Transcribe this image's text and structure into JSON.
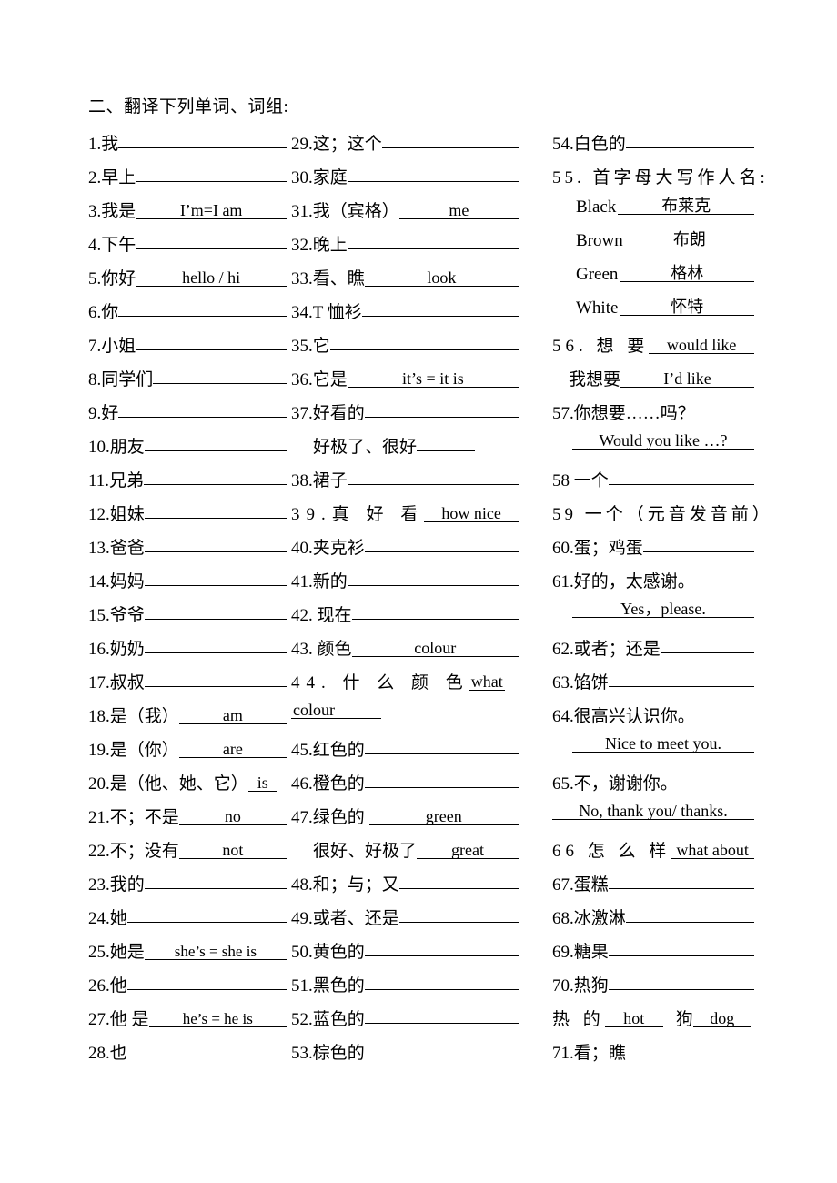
{
  "document": {
    "heading": "二、翻译下列单词、词组:"
  },
  "columns": [
    {
      "name": "column-1",
      "entries": [
        {
          "num": "1.",
          "label": "我",
          "answer": ""
        },
        {
          "num": "2.",
          "label": "早上",
          "answer": ""
        },
        {
          "num": "3.",
          "label": "我是",
          "answer": "I’m=I am"
        },
        {
          "num": "4.",
          "label": "下午",
          "answer": ""
        },
        {
          "num": "5.",
          "label": "你好",
          "answer": "hello / hi"
        },
        {
          "num": "6.",
          "label": "你",
          "answer": ""
        },
        {
          "num": "7.",
          "label": "小姐",
          "answer": ""
        },
        {
          "num": "8.",
          "label": "同学们",
          "answer": ""
        },
        {
          "num": "9.",
          "label": "好",
          "answer": ""
        },
        {
          "num": "10.",
          "label": "朋友",
          "answer": ""
        },
        {
          "num": "11.",
          "label": "兄弟",
          "answer": ""
        },
        {
          "num": "12.",
          "label": "姐妹",
          "answer": ""
        },
        {
          "num": "13.",
          "label": "爸爸",
          "answer": ""
        },
        {
          "num": "14.",
          "label": "妈妈",
          "answer": ""
        },
        {
          "num": "15.",
          "label": "爷爷",
          "answer": ""
        },
        {
          "num": "16.",
          "label": "奶奶",
          "answer": ""
        },
        {
          "num": "17.",
          "label": "叔叔",
          "answer": ""
        },
        {
          "num": "18.",
          "label": "是（我）",
          "answer": "am"
        },
        {
          "num": "19.",
          "label": "是（你）",
          "answer": "are"
        },
        {
          "num": "20.",
          "label": "是（他、她、它）",
          "answer": "is"
        },
        {
          "num": "21.",
          "label": "不；不是",
          "answer": "no"
        },
        {
          "num": "22.",
          "label": "不；没有",
          "answer": "not"
        },
        {
          "num": "23.",
          "label": "我的",
          "answer": ""
        },
        {
          "num": "24.",
          "label": "她",
          "answer": ""
        },
        {
          "num": "25.",
          "label": "她是",
          "answer": "she’s = she is"
        },
        {
          "num": "26.",
          "label": "他",
          "answer": ""
        },
        {
          "num": "27.",
          "label": "他 是",
          "answer": "he’s = he is"
        },
        {
          "num": "28.",
          "label": "也",
          "answer": ""
        }
      ]
    },
    {
      "name": "column-2",
      "entries": [
        {
          "num": "29.",
          "label": "这；这个",
          "answer": ""
        },
        {
          "num": "30.",
          "label": "家庭",
          "answer": ""
        },
        {
          "num": "31.",
          "label": "我（宾格）",
          "answer": "me"
        },
        {
          "num": "32.",
          "label": "晚上",
          "answer": ""
        },
        {
          "num": "33.",
          "label": "看、瞧",
          "answer": "look"
        },
        {
          "num": "34.",
          "label": "T 恤衫",
          "answer": ""
        },
        {
          "num": "35.",
          "label": "它",
          "answer": ""
        },
        {
          "num": "36.",
          "label": "它是",
          "answer": "it’s = it is"
        },
        {
          "num": "37.",
          "label": "好看的",
          "answer": ""
        },
        {
          "num": "",
          "label": "好极了、很好",
          "answer": "",
          "sub": true
        },
        {
          "num": "38.",
          "label": "裙子",
          "answer": ""
        },
        {
          "num": "39.",
          "label": "真 好 看",
          "answer": "how  nice"
        },
        {
          "num": "40.",
          "label": "夹克衫",
          "answer": ""
        },
        {
          "num": "41.",
          "label": "新的",
          "answer": ""
        },
        {
          "num": "42.",
          "label": "现在",
          "answer": ""
        },
        {
          "num": "43.",
          "label": "颜色",
          "answer": "colour"
        },
        {
          "num": "44.",
          "label": "什 么 颜 色",
          "answer": "what"
        },
        {
          "num": "",
          "label": "",
          "answer": "colour",
          "wrap": true
        },
        {
          "num": "45.",
          "label": "红色的",
          "answer": ""
        },
        {
          "num": "46.",
          "label": "橙色的",
          "answer": ""
        },
        {
          "num": "47.",
          "label": "绿色的",
          "answer": "green"
        },
        {
          "num": "",
          "label": "很好、好极了",
          "answer": "great",
          "sub": true
        },
        {
          "num": "48.",
          "label": "和；与；又",
          "answer": ""
        },
        {
          "num": "49.",
          "label": "或者、还是",
          "answer": ""
        },
        {
          "num": "50.",
          "label": "黄色的",
          "answer": ""
        },
        {
          "num": "51.",
          "label": "黑色的",
          "answer": ""
        },
        {
          "num": "52.",
          "label": "蓝色的",
          "answer": ""
        },
        {
          "num": "53.",
          "label": "棕色的",
          "answer": ""
        }
      ]
    },
    {
      "name": "column-3",
      "entries": [
        {
          "num": "54.",
          "label": "白色的",
          "answer": ""
        },
        {
          "num": "55.",
          "label": "首字母大写作人名:",
          "answer": "",
          "noline": true
        },
        {
          "num": "",
          "label": "Black",
          "answer": "布莱克",
          "name_row": true
        },
        {
          "num": "",
          "label": "Brown",
          "answer": "布朗",
          "name_row": true
        },
        {
          "num": "",
          "label": "Green",
          "answer": "格林",
          "name_row": true
        },
        {
          "num": "",
          "label": "White",
          "answer": "怀特",
          "name_row": true
        },
        {
          "num": "56.",
          "label": "想 要",
          "answer": "would  like"
        },
        {
          "num": "",
          "label": "我想要",
          "answer": "I’d like",
          "sub": true
        },
        {
          "num": "57.",
          "label": "你想要……吗？",
          "answer": "",
          "noline": true
        },
        {
          "num": "",
          "label": "",
          "answer": "Would you like …?",
          "answer_line": true
        },
        {
          "num": "58",
          "label": "一个",
          "answer": ""
        },
        {
          "num": "59",
          "label": "一个（元音发音前）",
          "answer": "",
          "noline": true
        },
        {
          "num": "60.",
          "label": "蛋；鸡蛋",
          "answer": ""
        },
        {
          "num": "61.",
          "label": "好的，太感谢。",
          "answer": "",
          "noline": true
        },
        {
          "num": "",
          "label": "",
          "answer": "Yes，please.",
          "answer_line": true
        },
        {
          "num": "62.",
          "label": "或者；还是",
          "answer": ""
        },
        {
          "num": "63.",
          "label": "馅饼",
          "answer": ""
        },
        {
          "num": "64.",
          "label": "很高兴认识你。",
          "answer": "",
          "noline": true
        },
        {
          "num": "",
          "label": "",
          "answer": "Nice to meet you.",
          "answer_line": true
        },
        {
          "num": "65.",
          "label": "不，谢谢你。",
          "answer": "",
          "noline": true
        },
        {
          "num": "",
          "label": "",
          "answer": "No, thank you/ thanks.",
          "answer_line": true
        },
        {
          "num": "66",
          "label": "怎 么 样",
          "answer": "what  about"
        },
        {
          "num": "67.",
          "label": "蛋糕",
          "answer": ""
        },
        {
          "num": "68.",
          "label": "冰激淋",
          "answer": ""
        },
        {
          "num": "69.",
          "label": "糖果",
          "answer": ""
        },
        {
          "num": "70.",
          "label": "热狗",
          "answer": ""
        },
        {
          "num": "",
          "label_a": "热 的",
          "answer_a": "hot",
          "label_b": "狗",
          "answer_b": "dog",
          "pair": true
        },
        {
          "num": "71.",
          "label": "看；瞧",
          "answer": ""
        }
      ]
    }
  ]
}
